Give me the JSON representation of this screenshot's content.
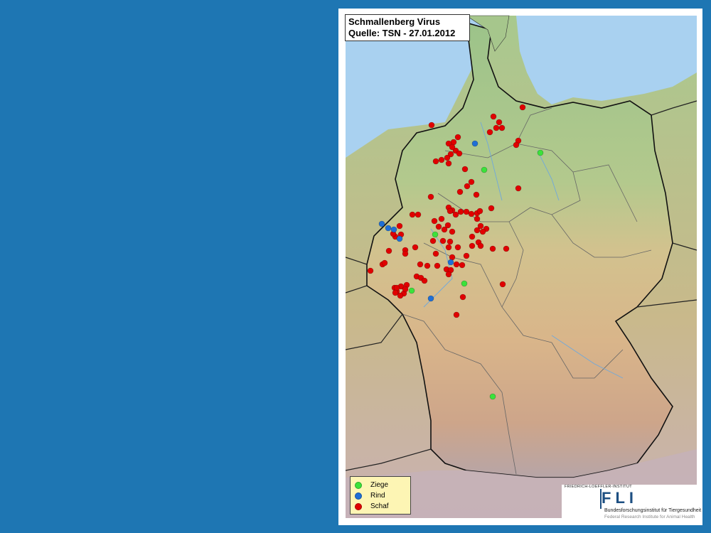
{
  "map": {
    "title_line1": "Schmallenberg Virus",
    "title_line2": "Quelle: TSN -  27.01.2012",
    "colors": {
      "ziege": "#3be23b",
      "rind": "#1f6fd6",
      "schaf": "#e00000",
      "sea": "#a9d1f0",
      "page_background": "#1e76b3"
    },
    "legend": [
      {
        "label": "Ziege",
        "color": "#3be23b"
      },
      {
        "label": "Rind",
        "color": "#1f6fd6"
      },
      {
        "label": "Schaf",
        "color": "#e00000"
      }
    ],
    "logo": {
      "top_text": "FRIEDRICH-LOEFFLER-INSTITUT",
      "letters": "FLI",
      "subtitle_de": "Bundesforschungsinstitut für Tiergesundheit",
      "subtitle_en": "Federal Research Institute for Animal Health"
    }
  }
}
